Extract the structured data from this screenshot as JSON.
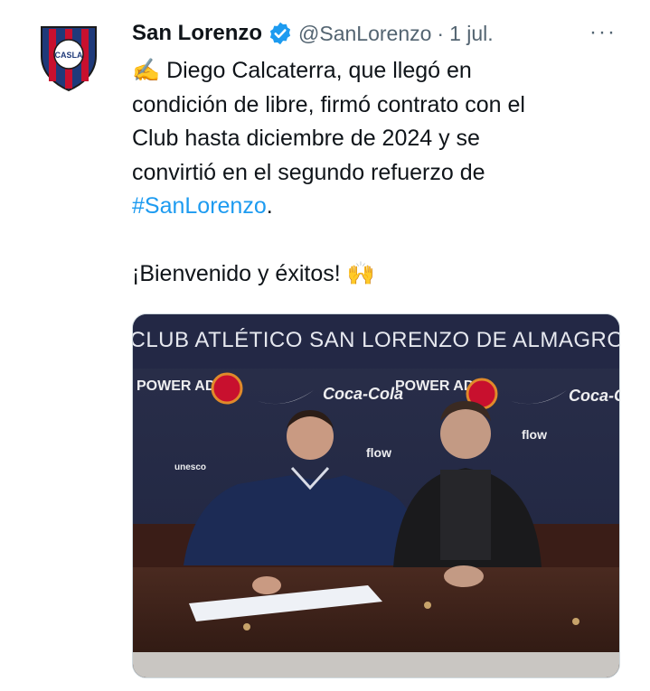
{
  "tweet": {
    "author_name": "San Lorenzo",
    "handle": "@SanLorenzo",
    "separator": "·",
    "date": "1 jul.",
    "more": "···",
    "avatar_text": "CASLA",
    "lines": [
      "✍️ Diego Calcaterra, que llegó en",
      "condición de libre, firmó contrato con el",
      "Club hasta diciembre de 2024 y se",
      "convirtió en el segundo refuerzo de"
    ],
    "hashtag": "#SanLorenzo",
    "hashtag_suffix": ".",
    "welcome": "¡Bienvenido y éxitos! 🙌"
  },
  "photo": {
    "banner": "CLUB ATLÉTICO SAN LORENZO DE ALMAGRO",
    "brands": [
      "POWER ADE",
      "Coca-Cola",
      "flow",
      "unesco"
    ]
  },
  "colors": {
    "club_blue": "#1f3a7a",
    "club_red": "#c8102e",
    "link": "#1d9bf0",
    "verified": "#1d9bf0"
  }
}
